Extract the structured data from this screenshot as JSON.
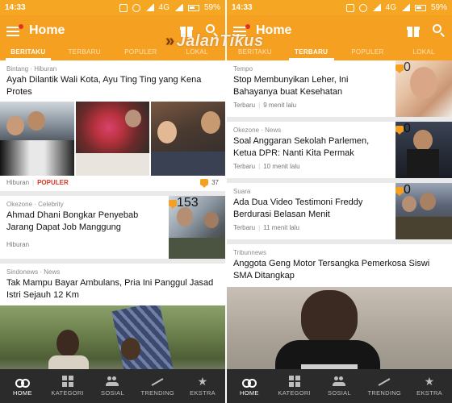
{
  "left": {
    "status": {
      "time": "14:33",
      "network": "4G",
      "battery": "59%"
    },
    "appbar": {
      "title": "Home"
    },
    "tabs": [
      "BERITAKU",
      "TERBARU",
      "POPULER",
      "LOKAL"
    ],
    "active_tab": 0,
    "articles": [
      {
        "source": "Bintang · Hiburan",
        "title": "Ayah Dilantik Wali Kota, Ayu Ting Ting yang Kena Protes",
        "category": "Hiburan",
        "badge": "POPULER",
        "comments": "37"
      },
      {
        "source": "Okezone · Celebrity",
        "title": "Ahmad Dhani Bongkar Penyebab Jarang Dapat Job Manggung",
        "category": "Hiburan",
        "comments": "153"
      },
      {
        "source": "Sindonews · News",
        "title": "Tak Mampu Bayar Ambulans, Pria Ini Panggul Jasad Istri Sejauh 12 Km"
      }
    ],
    "nav": [
      "HOME",
      "KATEGORI",
      "SOSIAL",
      "TRENDING",
      "EKSTRA"
    ]
  },
  "right": {
    "status": {
      "time": "14:33",
      "network": "4G",
      "battery": "59%"
    },
    "appbar": {
      "title": "Home"
    },
    "tabs": [
      "BERITAKU",
      "TERBARU",
      "POPULER",
      "LOKAL"
    ],
    "active_tab": 1,
    "articles": [
      {
        "source": "Tempo",
        "title": "Stop Membunyikan Leher, Ini Bahayanya buat Kesehatan",
        "category": "Terbaru",
        "time": "9 menit lalu",
        "comments": "0"
      },
      {
        "source": "Okezone · News",
        "title": "Soal Anggaran Sekolah Parlemen, Ketua DPR: Nanti Kita Permak",
        "category": "Terbaru",
        "time": "10 menit lalu",
        "comments": "0"
      },
      {
        "source": "Suara",
        "title": "Ada Dua Video Testimoni Freddy Berdurasi Belasan Menit",
        "category": "Terbaru",
        "time": "11 menit lalu",
        "comments": "0"
      },
      {
        "source": "Tribunnews",
        "title": "Anggota Geng Motor Tersangka Pemerkosa Siswi SMA Ditangkap"
      }
    ],
    "nav": [
      "HOME",
      "KATEGORI",
      "SOSIAL",
      "TRENDING",
      "EKSTRA"
    ]
  },
  "watermark": "JalanTikus",
  "colors": {
    "brand": "#f6a021",
    "hot": "#e0321f",
    "nav_bg": "#2b2b2b"
  }
}
